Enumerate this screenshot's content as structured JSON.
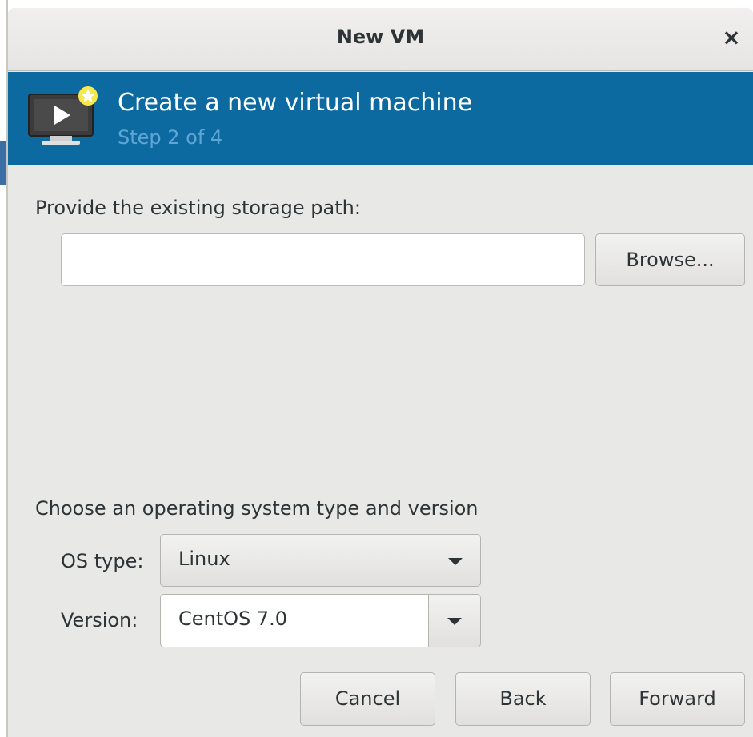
{
  "window": {
    "title": "New VM",
    "close_label": "×"
  },
  "banner": {
    "icon": "vm-monitor-new-icon",
    "heading": "Create a new virtual machine",
    "subheading": "Step 2 of 4",
    "background_color": "#0c6aa1"
  },
  "storage": {
    "prompt": "Provide the existing storage path:",
    "path_value": "",
    "browse_label": "Browse..."
  },
  "os": {
    "section_label": "Choose an operating system type and version",
    "type_label": "OS type:",
    "type_value": "Linux",
    "version_label": "Version:",
    "version_value": "CentOS 7.0"
  },
  "buttons": {
    "cancel": "Cancel",
    "back": "Back",
    "forward": "Forward"
  }
}
